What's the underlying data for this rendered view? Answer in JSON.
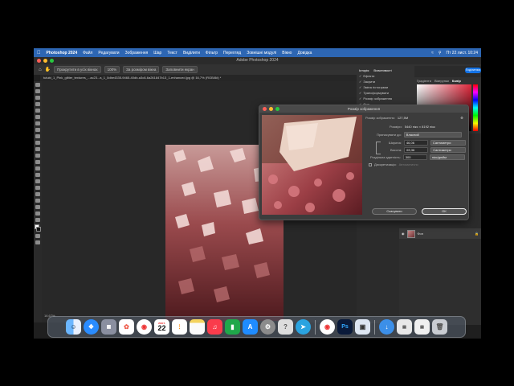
{
  "menubar": {
    "app_name": "Photoshop 2024",
    "items": [
      "Файл",
      "Редагувати",
      "Зображення",
      "Шар",
      "Текст",
      "Виділити",
      "Фільтр",
      "Перегляд"
    ],
    "right_items": [
      "Зовнішні модулі",
      "Вікно",
      "Довідка"
    ],
    "clock": "Пт 22 лист. 10:24"
  },
  "window": {
    "title": "Adobe Photoshop 2024"
  },
  "options_bar": {
    "buttons": [
      "Прокрутити в усіх вікнах",
      "100%",
      "За розміром вікна",
      "Заповнити екран"
    ]
  },
  "document": {
    "tab_label": "tutubi_1_Pink_glitter_textures_...ac23...a_1_0dbe4335-9465-40db-a3c8-6a261847b13_1-enhanced.jpg @ 16,7% (RGB/8#) *",
    "status": "16,67%"
  },
  "history_panel": {
    "tabs": [
      "Історія",
      "Властивості"
    ],
    "items": [
      "Ефекти",
      "Закрити",
      "Зміна гістограми",
      "Трансформувати",
      "Розмір зображення",
      "Фон"
    ]
  },
  "color_panel": {
    "tabs": [
      "Градієнти",
      "Візерунки",
      "Колір"
    ],
    "share_label": "Поділитися"
  },
  "layers_panel": {
    "layer_name": "Фон",
    "lock_icon": "lock-icon"
  },
  "image_size_dialog": {
    "title": "Розмір зображення",
    "image_size_label": "Розмір зображення:",
    "image_size_value": "127,5М",
    "dimensions_label": "Розміри:",
    "dimensions_value": "5440 пікс × 8192 пікс",
    "fit_label": "Припасувати до:",
    "fit_value": "Власний",
    "width_label": "Ширина:",
    "width_value": "46,06",
    "width_unit": "Сантиметри",
    "height_label": "Висота:",
    "height_value": "69,36",
    "height_unit": "Сантиметри",
    "resolution_label": "Роздільна здатність:",
    "resolution_value": "300",
    "resolution_unit": "пікс/дюйм",
    "resample_label": "Дискретизація:",
    "resample_value": "Автоматично",
    "cancel_label": "Скасувати",
    "ok_label": "OK"
  },
  "dock": {
    "apps": [
      "Finder",
      "Safari",
      "Launchpad",
      "Photos",
      "Chrome",
      "Calendar",
      "Reminders",
      "Notes",
      "Music",
      "Numbers",
      "App Store",
      "System Settings",
      "Help",
      "Telegram",
      "Chrome",
      "Photoshop",
      "Preview",
      "Downloads",
      "Trash"
    ],
    "calendar_month": "лист.",
    "calendar_day": "22"
  }
}
